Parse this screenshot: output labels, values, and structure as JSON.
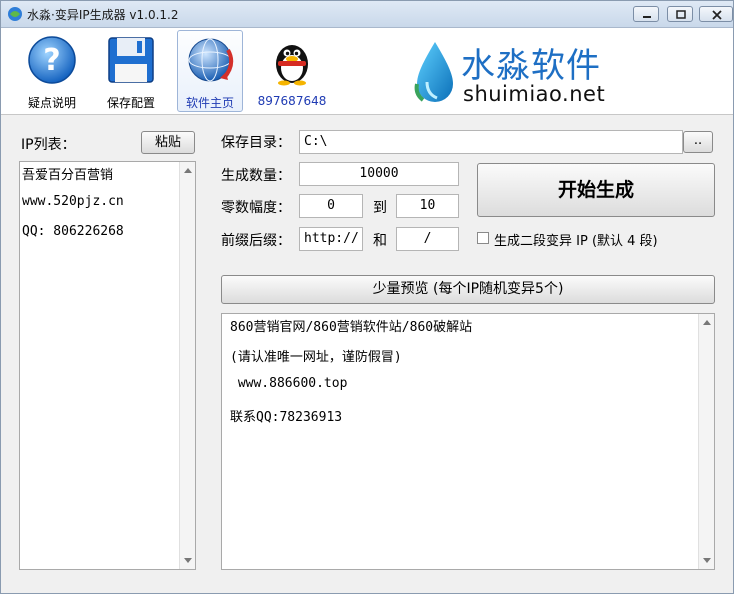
{
  "window": {
    "title": "水淼·变异IP生成器 v1.0.1.2"
  },
  "toolbar": {
    "items": [
      {
        "label": "疑点说明"
      },
      {
        "label": "保存配置"
      },
      {
        "label": "软件主页"
      },
      {
        "label": "897687648"
      }
    ]
  },
  "logo": {
    "cn": "水淼软件",
    "en": "shuimiao.net"
  },
  "ip_list": {
    "label": "IP列表：",
    "paste_button": "粘贴",
    "lines": [
      "吾爱百分百营销",
      "www.520pjz.cn",
      "QQ: 806226268"
    ]
  },
  "save_dir": {
    "label": "保存目录：",
    "value": "C:\\",
    "browse_button": ".."
  },
  "count": {
    "label": "生成数量：",
    "value": "10000"
  },
  "zero_range": {
    "label": "零数幅度：",
    "from": "0",
    "to_label": "到",
    "to": "10"
  },
  "affix": {
    "label": "前缀后缀：",
    "prefix": "http://",
    "and_label": "和",
    "suffix": "/"
  },
  "start_button": "开始生成",
  "second_segment": {
    "label": "生成二段变异 IP (默认 4 段)",
    "checked": false
  },
  "preview_button": "少量预览 (每个IP随机变异5个)",
  "preview": {
    "lines": [
      "860营销官网/860营销软件站/860破解站",
      "(请认准唯一网址，谨防假冒)",
      " www.886600.top",
      "联系QQ:78236913"
    ]
  }
}
